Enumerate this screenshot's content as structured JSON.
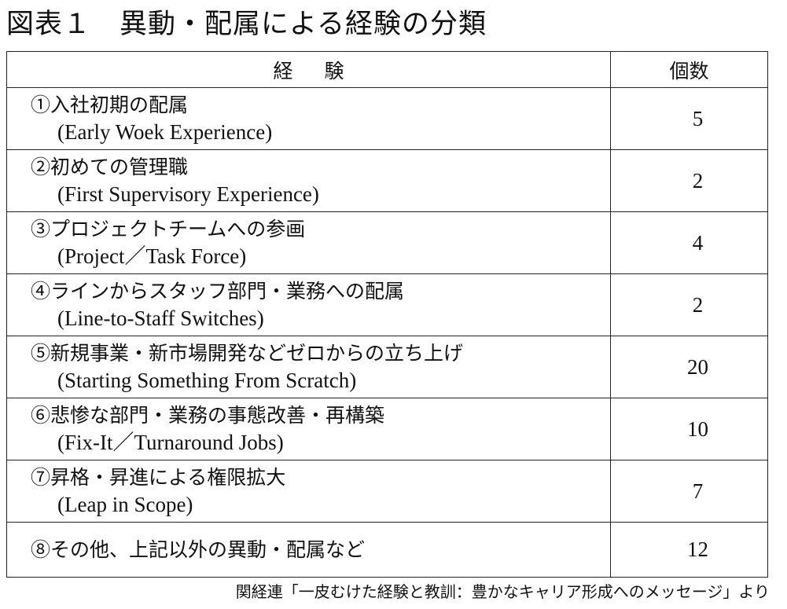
{
  "title": "図表１　異動・配属による経験の分類",
  "table": {
    "header_experience_1": "経",
    "header_experience_2": "験",
    "header_count": "個数",
    "rows": [
      {
        "jp": "①入社初期の配属",
        "en": "(Early Woek Experience)",
        "count": "5"
      },
      {
        "jp": "②初めての管理職",
        "en": "(First Supervisory Experience)",
        "count": "2"
      },
      {
        "jp": "③プロジェクトチームへの参画",
        "en": "(Project／Task Force)",
        "count": "4"
      },
      {
        "jp": "④ラインからスタッフ部門・業務への配属",
        "en": "(Line-to-Staff Switches)",
        "count": "2"
      },
      {
        "jp": "⑤新規事業・新市場開発などゼロからの立ち上げ",
        "en": "(Starting Something From Scratch)",
        "count": "20"
      },
      {
        "jp": "⑥悲惨な部門・業務の事態改善・再構築",
        "en": "(Fix-It／Turnaround Jobs)",
        "count": "10"
      },
      {
        "jp": "⑦昇格・昇進による権限拡大",
        "en": "(Leap in Scope)",
        "count": "7"
      },
      {
        "jp": "⑧その他、上記以外の異動・配属など",
        "en": "",
        "count": "12"
      }
    ]
  },
  "source": "関経連「一皮むけた経験と教訓：豊かなキャリア形成へのメッセージ」より"
}
